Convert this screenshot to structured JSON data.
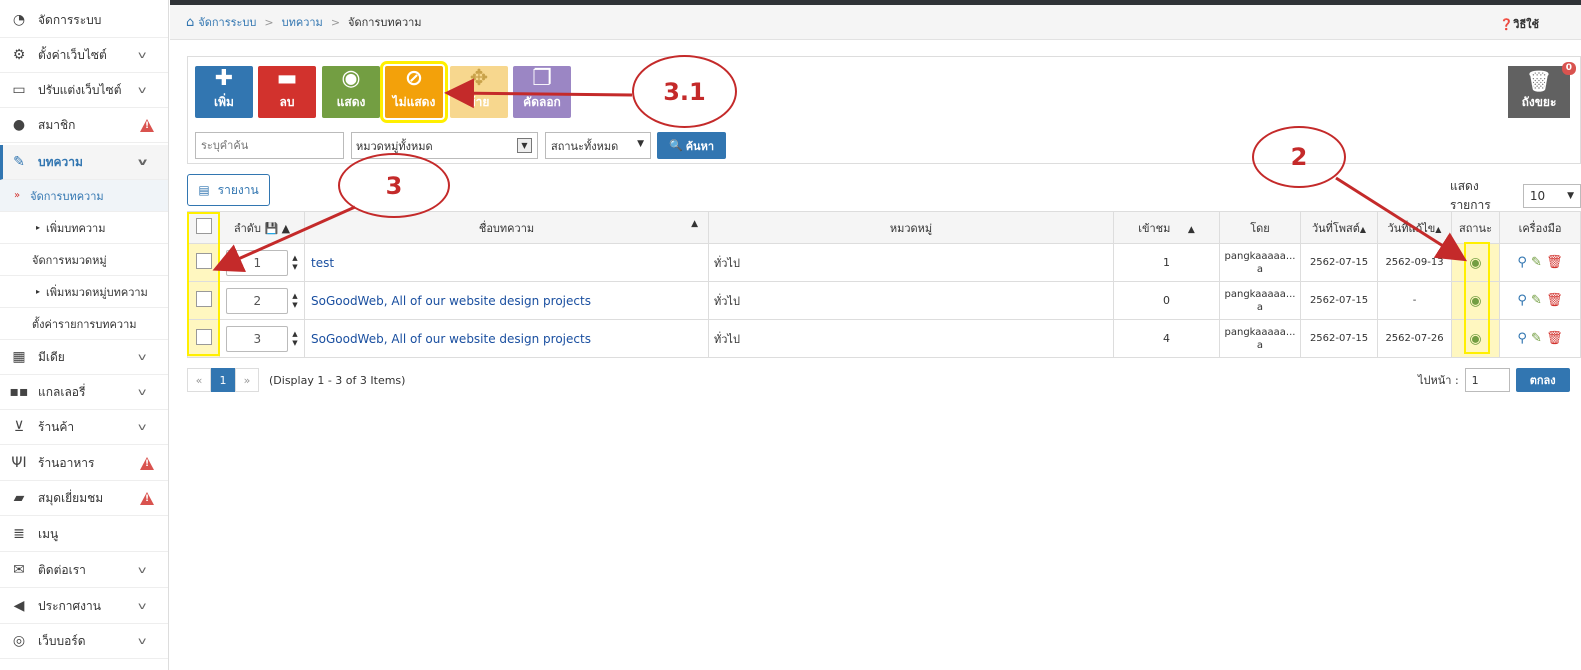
{
  "sidebar": {
    "items": [
      {
        "label": "จัดการระบบ",
        "icon": "dashboard-icon"
      },
      {
        "label": "ตั้งค่าเว็บไซต์",
        "icon": "gear-icon"
      },
      {
        "label": "ปรับแต่งเว็บไซต์",
        "icon": "monitor-icon"
      },
      {
        "label": "สมาชิก",
        "icon": "user-icon"
      },
      {
        "label": "บทความ",
        "icon": "edit-icon"
      },
      {
        "label": "มีเดีย",
        "icon": "film-icon"
      },
      {
        "label": "แกลเลอรี่",
        "icon": "grid-icon"
      },
      {
        "label": "ร้านค้า",
        "icon": "cart-icon"
      },
      {
        "label": "ร้านอาหาร",
        "icon": "cutlery-icon"
      },
      {
        "label": "สมุดเยี่ยมชม",
        "icon": "book-icon"
      },
      {
        "label": "เมนู",
        "icon": "menu-icon"
      },
      {
        "label": "ติดต่อเรา",
        "icon": "envelope-icon"
      },
      {
        "label": "ประกาศงาน",
        "icon": "megaphone-icon"
      },
      {
        "label": "เว็บบอร์ด",
        "icon": "comments-icon"
      }
    ],
    "subitems": [
      "จัดการบทความ",
      "เพิ่มบทความ",
      "จัดการหมวดหมู่",
      "เพิ่มหมวดหมู่บทความ",
      "ตั้งค่ารายการบทความ"
    ]
  },
  "breadcrumb": [
    "จัดการระบบ",
    "บทความ",
    "จัดการบทความ"
  ],
  "help_label": "วิธีใช้",
  "toolbar": {
    "add": "เพิ่ม",
    "delete": "ลบ",
    "show": "แสดง",
    "hide": "ไม่แสดง",
    "move": "ย้าย",
    "copy": "คัดลอก",
    "trash": "ถังขยะ",
    "trash_count": "0"
  },
  "filters": {
    "search_placeholder": "ระบุคำค้น",
    "category": "หมวดหมู่ทั้งหมด",
    "status": "สถานะทั้งหมด",
    "search_button": "ค้นหา"
  },
  "report_button": "รายงาน",
  "per_page": {
    "label": "แสดงรายการ",
    "value": "10"
  },
  "columns": [
    "ลำดับ",
    "ชื่อบทความ",
    "หมวดหมู่",
    "เข้าชม",
    "โดย",
    "วันที่โพสต์",
    "วันที่แก้ไข",
    "สถานะ",
    "เครื่องมือ"
  ],
  "rows": [
    {
      "order": "1",
      "title": "test",
      "category": "ทั่วไป",
      "views": "1",
      "by": "pangkaaaaa... a",
      "posted": "2562-07-15",
      "edited": "2562-09-13"
    },
    {
      "order": "2",
      "title": "SoGoodWeb, All of our website design projects",
      "category": "ทั่วไป",
      "views": "0",
      "by": "pangkaaaaa... a",
      "posted": "2562-07-15",
      "edited": "-"
    },
    {
      "order": "3",
      "title": "SoGoodWeb, All of our website design projects",
      "category": "ทั่วไป",
      "views": "4",
      "by": "pangkaaaaa... a",
      "posted": "2562-07-15",
      "edited": "2562-07-26"
    }
  ],
  "pager": {
    "prev": "«",
    "page": "1",
    "next": "»",
    "info": "(Display 1 - 3 of 3 Items)"
  },
  "goto": {
    "label": "ไปหน้า :",
    "value": "1",
    "button": "ตกลง"
  },
  "callouts": [
    "3.1",
    "3",
    "2"
  ],
  "colors": {
    "primary": "#3276b1",
    "danger": "#d2322d",
    "success": "#739e42",
    "warning": "#f3a10a",
    "annotation": "#c42a2a",
    "highlight": "#ffef00"
  }
}
